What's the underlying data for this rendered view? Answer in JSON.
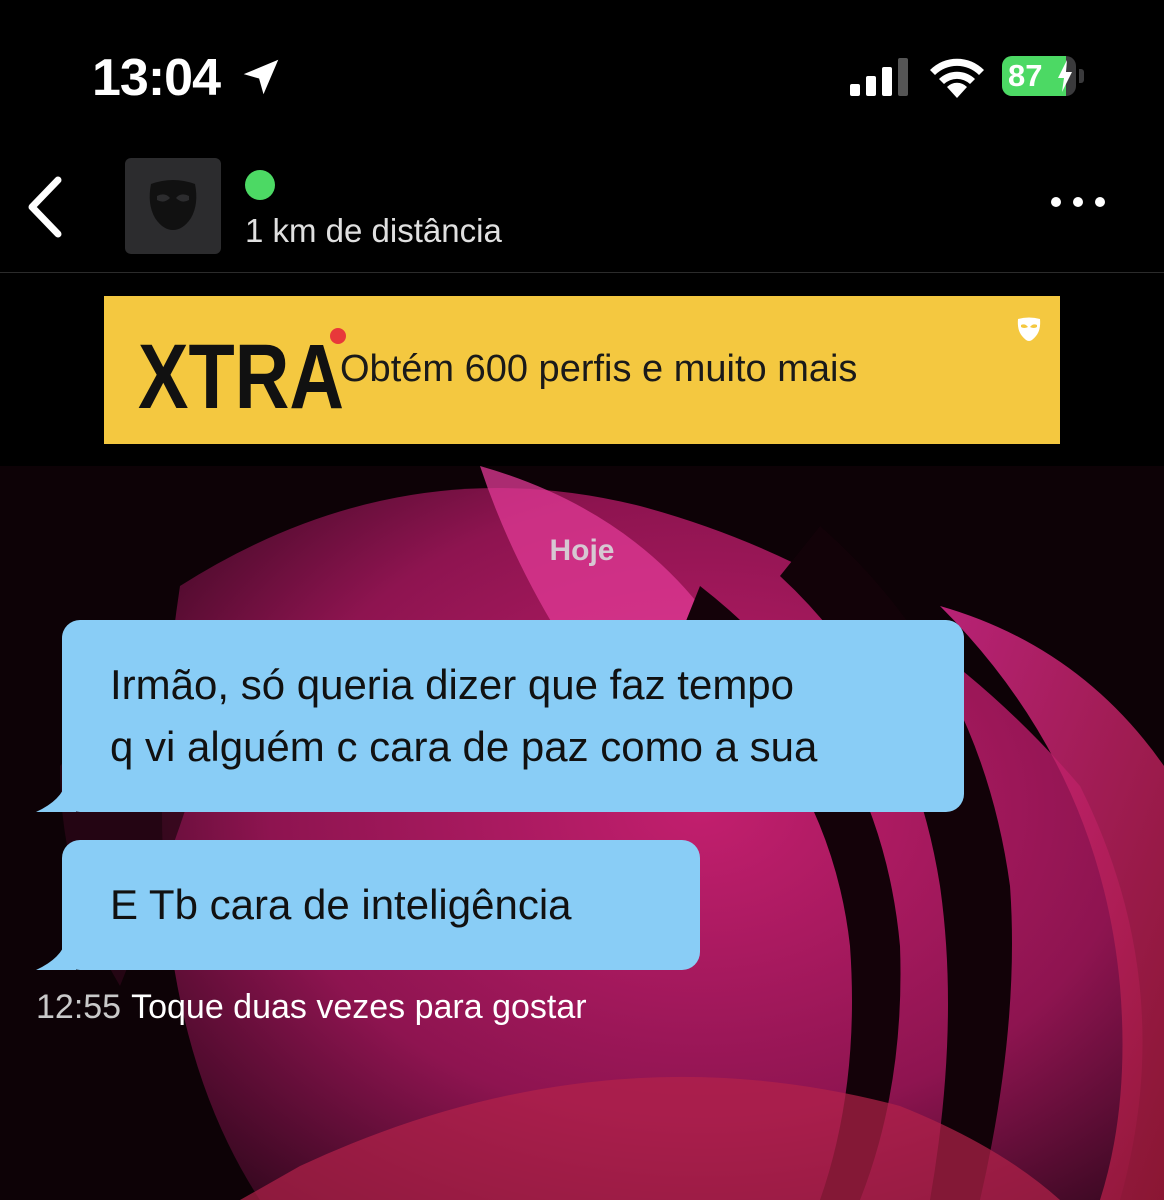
{
  "status_bar": {
    "time": "13:04",
    "battery": "87",
    "battery_level": 0.87,
    "icons": [
      "location-arrow-icon",
      "cellular-signal-icon",
      "wifi-icon",
      "battery-icon"
    ]
  },
  "header": {
    "distance": "1 km de distância",
    "online": true,
    "icons": [
      "back-chevron-icon",
      "mask-avatar-icon",
      "more-dots-icon"
    ]
  },
  "banner": {
    "logo": "XTRA",
    "text": "Obtém 600 perfis e muito mais",
    "background": "#f4c840"
  },
  "chat": {
    "date_label": "Hoje",
    "messages": [
      {
        "line1": "Irmão, só queria dizer que faz tempo",
        "line2": "q vi alguém c cara de paz como a sua"
      },
      {
        "line1": "E Tb cara de inteligência"
      }
    ],
    "bubble_color": "#89cdf6",
    "time": "12:55",
    "hint": "Toque duas vezes para gostar"
  }
}
